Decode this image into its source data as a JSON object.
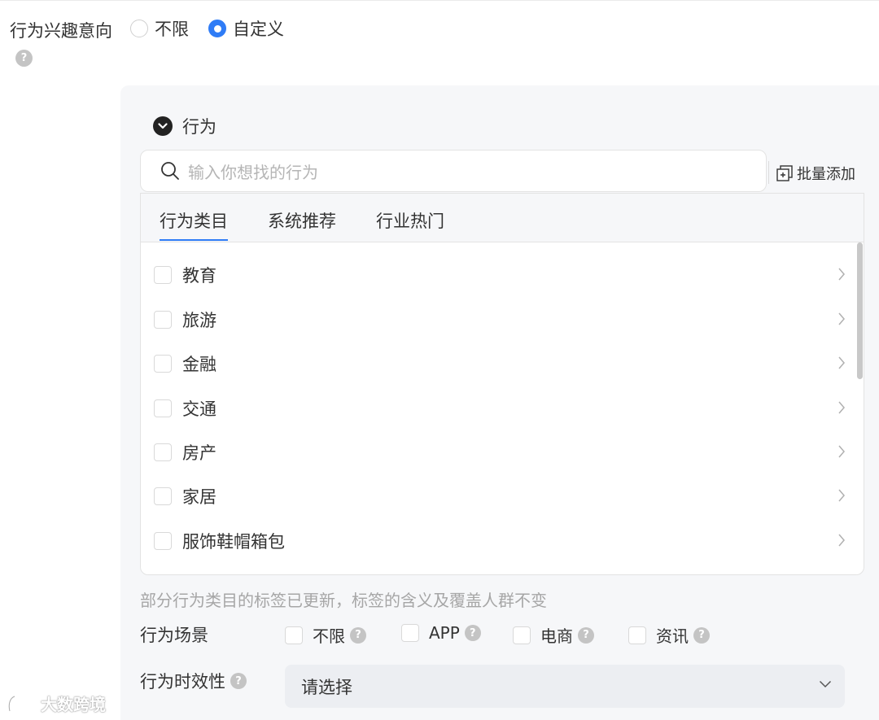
{
  "interest": {
    "label": "行为兴趣意向",
    "options": [
      {
        "label": "不限",
        "checked": false
      },
      {
        "label": "自定义",
        "checked": true
      }
    ]
  },
  "behavior": {
    "title": "行为",
    "search_placeholder": "输入你想找的行为",
    "batch_add": "批量添加",
    "tabs": [
      "行为类目",
      "系统推荐",
      "行业热门"
    ],
    "categories": [
      "教育",
      "旅游",
      "金融",
      "交通",
      "房产",
      "家居",
      "服饰鞋帽箱包"
    ],
    "note": "部分行为类目的标签已更新，标签的含义及覆盖人群不变"
  },
  "scene": {
    "label": "行为场景",
    "options": [
      "不限",
      "APP",
      "电商",
      "资讯"
    ]
  },
  "timeliness": {
    "label": "行为时效性",
    "placeholder": "请选择"
  },
  "watermark": "大数跨境",
  "colors": {
    "accent": "#2f7cf6",
    "panel_bg": "#f6f7f9",
    "muted": "#a6a6a6"
  }
}
